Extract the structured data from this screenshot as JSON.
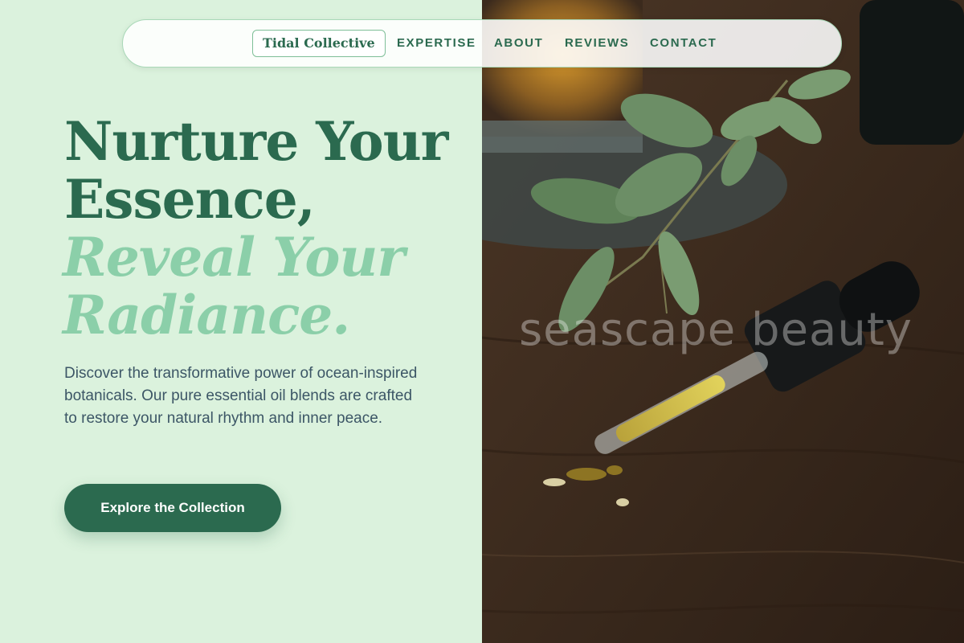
{
  "nav": {
    "brand": "Tidal Collective",
    "links": [
      "EXPERTISE",
      "ABOUT",
      "REVIEWS",
      "CONTACT"
    ]
  },
  "hero": {
    "line1": "Nurture Your",
    "line2": "Essence,",
    "line3": "Reveal Your",
    "line4": "Radiance.",
    "description": "Discover the transformative power of ocean-inspired botanicals. Our pure essential oil blends are crafted to restore your natural rhythm and inner peace.",
    "cta_label": "Explore the Collection"
  },
  "photo": {
    "watermark": "seascape beauty"
  },
  "colors": {
    "background": "#dbf2dd",
    "primary": "#2b6a4f",
    "accent": "#8bcfa9",
    "body_text": "#3c5666"
  }
}
